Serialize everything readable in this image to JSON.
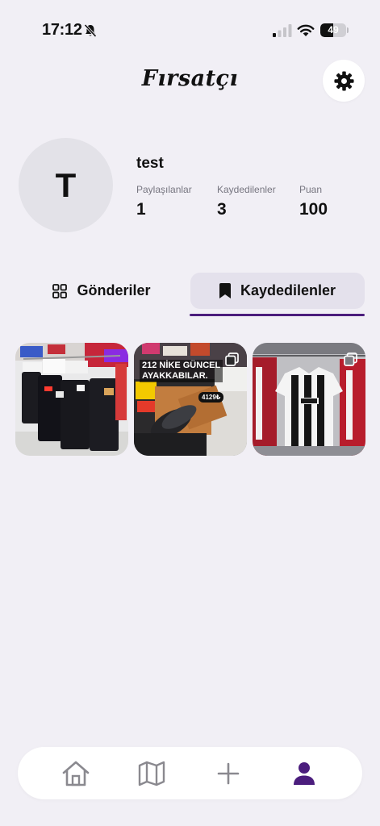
{
  "status_bar": {
    "time": "17:12",
    "battery_level": "49"
  },
  "header": {
    "title": "Fırsatçı",
    "settings_icon": "gear-icon"
  },
  "profile": {
    "avatar_initial": "T",
    "username": "test",
    "stats": [
      {
        "label": "Paylaşılanlar",
        "value": "1"
      },
      {
        "label": "Kaydedilenler",
        "value": "3"
      },
      {
        "label": "Puan",
        "value": "100"
      }
    ]
  },
  "tabs": [
    {
      "label": "Gönderiler",
      "icon": "grid-icon",
      "active": false
    },
    {
      "label": "Kaydedilenler",
      "icon": "bookmark-icon",
      "active": true
    }
  ],
  "saved_posts": [
    {
      "image": "shorts-rack-photo",
      "multiple": false
    },
    {
      "image": "nike-shoes-photo",
      "multiple": true,
      "caption_line1": "212 NİKE GÜNCEL",
      "caption_line2": "AYAKKABILAR.",
      "price": "4129₺"
    },
    {
      "image": "jerseys-rack-photo",
      "multiple": true
    }
  ],
  "bottom_nav": [
    {
      "name": "home",
      "icon": "home-icon",
      "active": false
    },
    {
      "name": "map",
      "icon": "map-icon",
      "active": false
    },
    {
      "name": "add",
      "icon": "plus-icon",
      "active": false
    },
    {
      "name": "profile",
      "icon": "person-icon",
      "active": true
    }
  ],
  "colors": {
    "accent": "#4b1d7d",
    "background": "#f1eff5",
    "tab_active_bg": "#e4e1ec"
  }
}
